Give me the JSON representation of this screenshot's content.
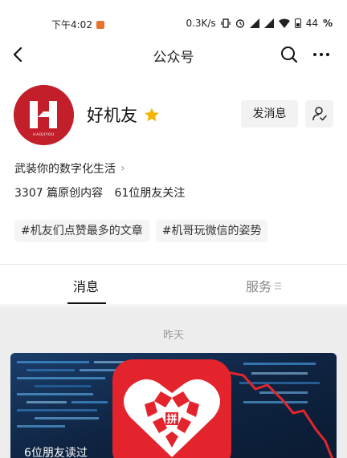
{
  "status_bar": {
    "time": "下午4:02",
    "speed": "0.3K/s",
    "battery": "44"
  },
  "nav": {
    "title": "公众号"
  },
  "profile": {
    "name": "好机友",
    "intro": "武装你的数字化生活",
    "articles": "3307 篇原创内容",
    "friends_following": "61位朋友关注",
    "message_button": "发消息",
    "avatar_logo_text": "HAOJIYOU"
  },
  "tags": [
    "#机友们点赞最多的文章",
    "#机哥玩微信的姿势"
  ],
  "tabs": {
    "messages": "消息",
    "services": "服务"
  },
  "feed": {
    "date": "昨天",
    "card_caption": "6位朋友读过"
  },
  "colors": {
    "brand_red": "#c21f2b",
    "star_gold": "#f5b400",
    "feed_bg": "#ededed"
  }
}
